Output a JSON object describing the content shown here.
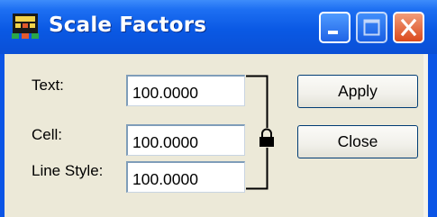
{
  "window": {
    "title": "Scale Factors",
    "icon": "scale-factors-app-icon"
  },
  "title_buttons": {
    "minimize": "minimize-icon",
    "maximize": "maximize-icon",
    "close": "close-icon"
  },
  "fields": {
    "text": {
      "label": "Text:",
      "value": "100.0000"
    },
    "cell": {
      "label": "Cell:",
      "value": "100.0000"
    },
    "line_style": {
      "label": "Line Style:",
      "value": "100.0000"
    }
  },
  "lock": {
    "icon": "lock-icon",
    "state": "locked"
  },
  "buttons": {
    "apply": "Apply",
    "close": "Close"
  },
  "colors": {
    "titlebar": "#0a59e4",
    "dialog_face": "#ece9d8",
    "close_button": "#db4a1c"
  }
}
